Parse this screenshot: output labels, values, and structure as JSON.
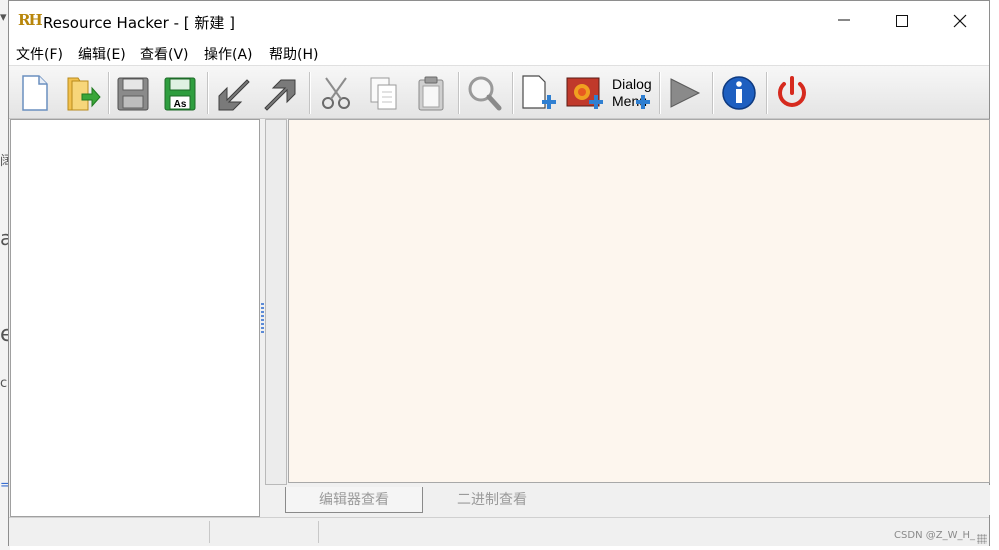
{
  "window": {
    "title": "Resource Hacker - [ 新建 ]",
    "logo_text": "RH"
  },
  "menu": [
    "文件(F)",
    "编辑(E)",
    "查看(V)",
    "操作(A)",
    "帮助(H)"
  ],
  "toolbar": {
    "dialog_menu_line1": "Dialog",
    "dialog_menu_line2": "Menu",
    "save_as_badge": "As"
  },
  "tabs": {
    "editor": "编辑器查看",
    "binary": "二进制查看"
  },
  "status": {
    "watermark": "CSDN @Z_W_H_"
  },
  "colors": {
    "editor_background": "#fdf6ee",
    "info_blue": "#1e5fc0",
    "power_red": "#d62a1e",
    "plus_blue": "#2f7fd1"
  },
  "icons": [
    "new-file-icon",
    "open-icon",
    "save-icon",
    "save-as-icon",
    "import-icon",
    "export-icon",
    "cut-icon",
    "copy-icon",
    "paste-icon",
    "find-icon",
    "add-resource-icon",
    "add-image-icon",
    "dialog-menu-icon",
    "run-script-icon",
    "about-icon",
    "exit-icon"
  ],
  "background_fragments": [
    "▾",
    "阔",
    "a",
    "e",
    "c",
    "="
  ]
}
